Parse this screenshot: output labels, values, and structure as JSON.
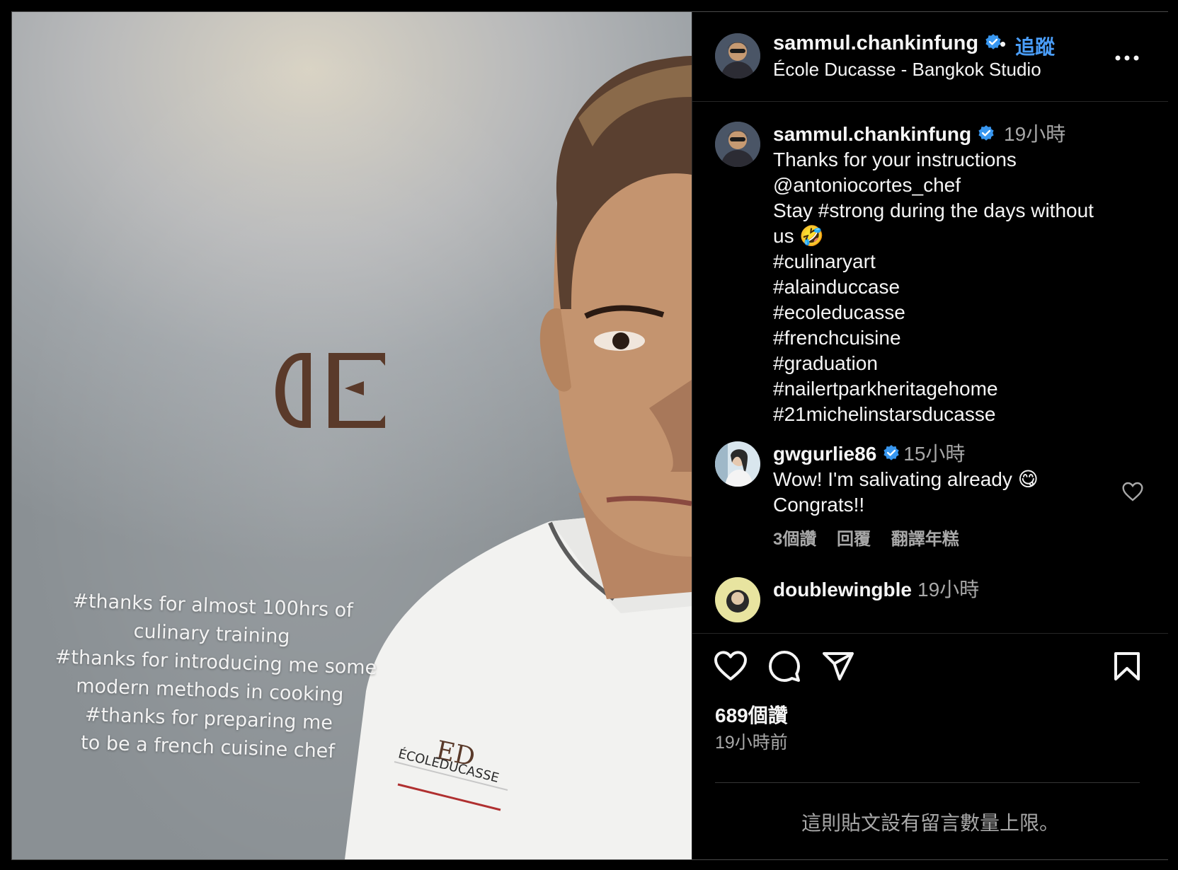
{
  "post": {
    "username": "sammul.chankinfung",
    "separator": "•",
    "follow_label": "追蹤",
    "location": "École Ducasse - Bangkok Studio",
    "photo_caption_lines": [
      "#thanks for almost 100hrs of",
      "culinary training",
      "#thanks for introducing me some",
      "modern methods in cooking",
      "#thanks for preparing me",
      "to be a french cuisine chef"
    ],
    "shirt_brand": "ÉCOLEDUCASSE",
    "shirt_sub": "NAI LERT BANGKOK STUDIO"
  },
  "caption": {
    "username": "sammul.chankinfung",
    "time": "19小時",
    "lines": [
      "Thanks for your instructions",
      "@antoniocortes_chef",
      "Stay #strong during the days without",
      "us 🤣",
      "#culinaryart",
      "#alainduccase",
      "#ecoleducasse",
      "#frenchcuisine",
      "#graduation",
      "#nailertparkheritagehome",
      "#21michelinstarsducasse"
    ]
  },
  "comments": [
    {
      "username": "gwgurlie86",
      "time": "15小時",
      "lines": [
        "Wow! I'm salivating already 😋",
        "Congrats!!"
      ],
      "likes": "3個讚",
      "reply": "回覆",
      "translate": "翻譯年糕"
    },
    {
      "username": "doublewingble",
      "time": "19小時"
    }
  ],
  "footer": {
    "likes": "689個讚",
    "posted": "19小時前",
    "comment_limit": "這則貼文設有留言數量上限。"
  },
  "colors": {
    "accent": "#4a9df8",
    "verified": "#3897f0",
    "muted": "#a8a8a8"
  },
  "icons": [
    "verified-badge-icon",
    "more-options-icon",
    "heart-icon",
    "comment-icon",
    "share-icon",
    "bookmark-icon"
  ]
}
